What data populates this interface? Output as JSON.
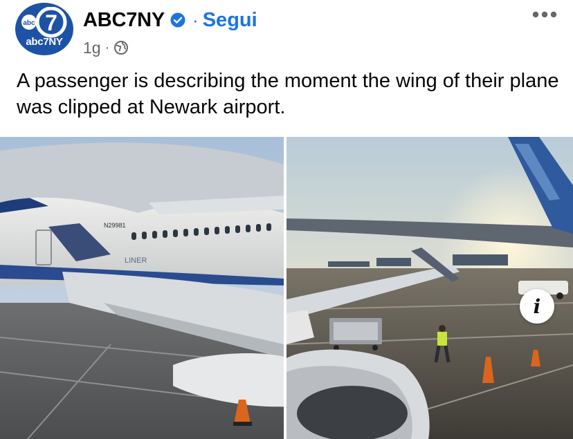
{
  "post": {
    "author": {
      "name": "ABC7NY",
      "avatar_logo_text": "abc",
      "avatar_logo_number": "7",
      "avatar_text": "abc7NY",
      "verified_icon": "verified-badge-icon"
    },
    "follow_separator": "·",
    "follow_label": "Segui",
    "time": "1g",
    "meta_separator": "·",
    "audience_icon": "globe-icon",
    "more_icon": "more-options-icon",
    "caption": "A passenger is describing the moment the wing of their plane was clipped at Newark airport.",
    "photos": [
      {
        "name": "left-photo",
        "visible_text": {
          "registration": "N29981",
          "livery": "LINER"
        }
      },
      {
        "name": "right-photo"
      }
    ],
    "info_button_glyph": "i"
  },
  "colors": {
    "accent": "#1b74e4",
    "secondary_text": "#65676b",
    "avatar_bg": "#1d53a6"
  }
}
